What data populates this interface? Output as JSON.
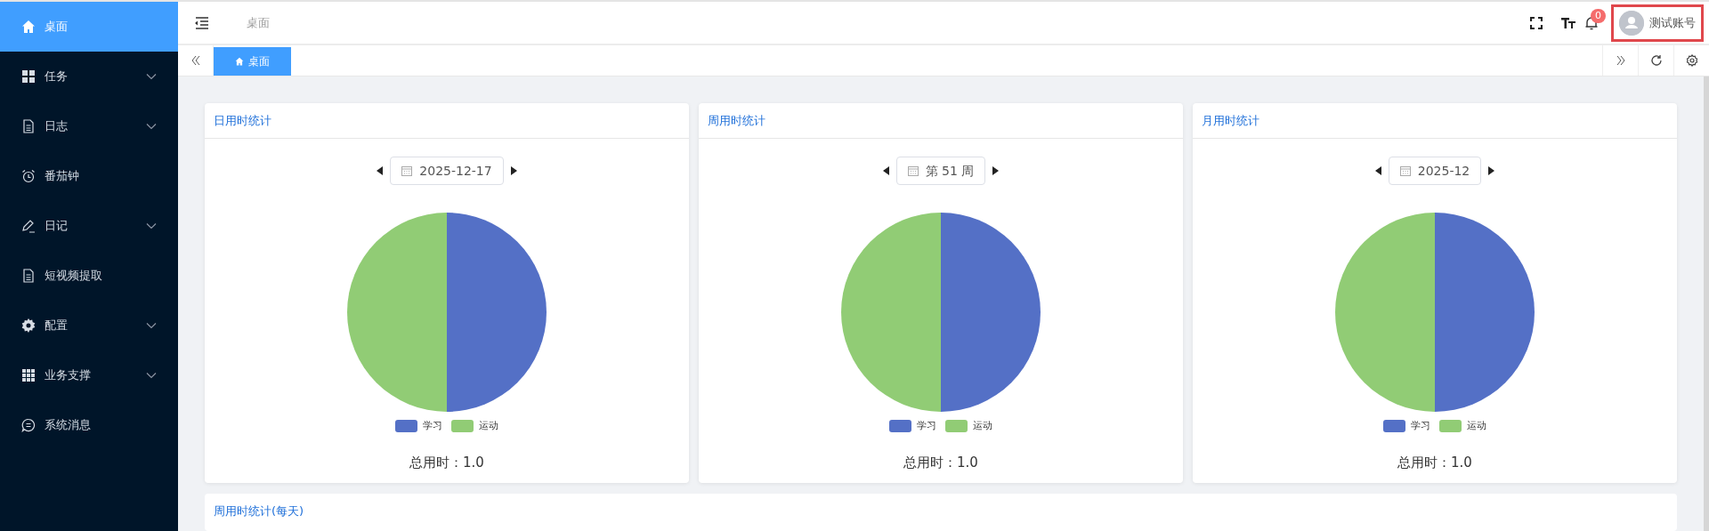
{
  "sidebar": {
    "items": [
      {
        "label": "桌面",
        "selected": true,
        "expandable": false
      },
      {
        "label": "任务",
        "selected": false,
        "expandable": true
      },
      {
        "label": "日志",
        "selected": false,
        "expandable": true
      },
      {
        "label": "番茄钟",
        "selected": false,
        "expandable": false
      },
      {
        "label": "日记",
        "selected": false,
        "expandable": true
      },
      {
        "label": "短视频提取",
        "selected": false,
        "expandable": false
      },
      {
        "label": "配置",
        "selected": false,
        "expandable": true
      },
      {
        "label": "业务支撑",
        "selected": false,
        "expandable": true
      },
      {
        "label": "系统消息",
        "selected": false,
        "expandable": false
      }
    ]
  },
  "header": {
    "breadcrumb": "桌面",
    "notification_count": "0",
    "user": "测试账号"
  },
  "tabs": [
    {
      "label": "桌面",
      "selected": true
    }
  ],
  "cards": [
    {
      "title": "日用时统计",
      "period": "2025-12-17",
      "legend": [
        {
          "label": "学习",
          "color": "#5470c6"
        },
        {
          "label": "运动",
          "color": "#91cc75"
        }
      ],
      "total": "总用时：1.0"
    },
    {
      "title": "周用时统计",
      "period": "第 51 周",
      "legend": [
        {
          "label": "学习",
          "color": "#5470c6"
        },
        {
          "label": "运动",
          "color": "#91cc75"
        }
      ],
      "total": "总用时：1.0"
    },
    {
      "title": "月用时统计",
      "period": "2025-12",
      "legend": [
        {
          "label": "学习",
          "color": "#5470c6"
        },
        {
          "label": "运动",
          "color": "#91cc75"
        }
      ],
      "total": "总用时：1.0"
    }
  ],
  "bottom_card": {
    "title": "周用时统计(每天)"
  }
}
